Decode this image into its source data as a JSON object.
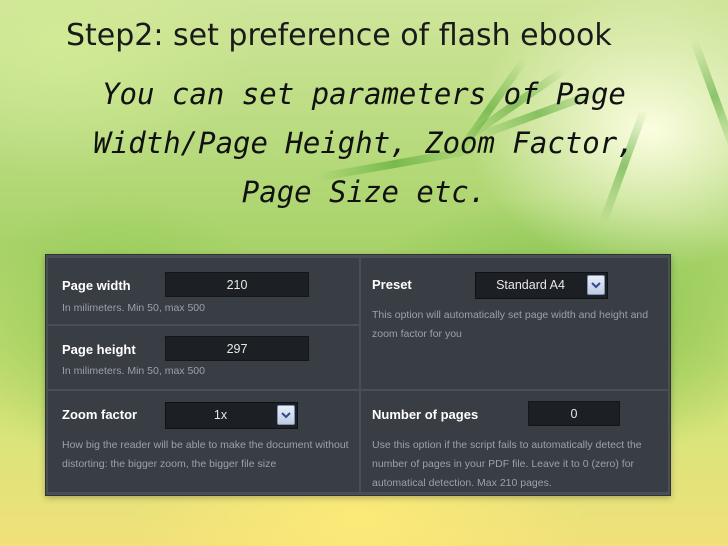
{
  "slide": {
    "title": "Step2: set preference of flash ebook",
    "subtitle": "You can set parameters of Page Width/Page Height, Zoom Factor, Page Size etc."
  },
  "settings": {
    "page_width": {
      "label": "Page width",
      "value": "210",
      "help": "In milimeters. Min 50, max 500"
    },
    "page_height": {
      "label": "Page height",
      "value": "297",
      "help": "In milimeters. Min 50, max 500"
    },
    "preset": {
      "label": "Preset",
      "selected": "Standard A4",
      "help": "This option will automatically set page width and height and zoom factor for you"
    },
    "zoom_factor": {
      "label": "Zoom factor",
      "selected": "1x",
      "help": "How big the reader will be able to make the document without distorting: the bigger zoom, the bigger file size"
    },
    "number_of_pages": {
      "label": "Number of pages",
      "value": "0",
      "help": "Use this option if the script fails to automatically detect the number of pages in your PDF file. Leave it to 0 (zero) for automatical detection. Max 210 pages."
    }
  },
  "icons": {
    "dropdown": "chevron-down-icon"
  },
  "colors": {
    "panel_bg": "#393e45",
    "panel_border": "#4a4f56",
    "input_bg": "#1c1f23",
    "dropdown_arrow": "#2f4a8a"
  }
}
